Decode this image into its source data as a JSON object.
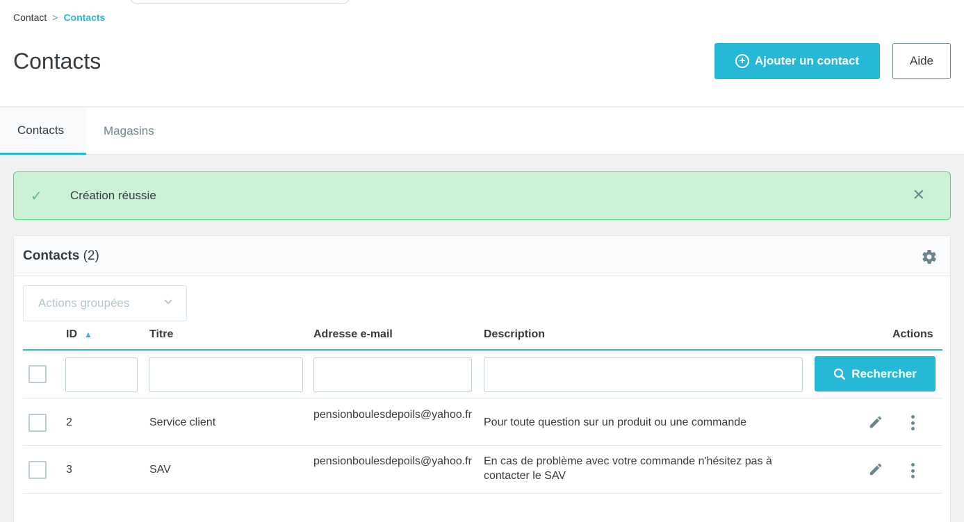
{
  "breadcrumb": {
    "parent": "Contact",
    "separator": ">",
    "current": "Contacts"
  },
  "page_title": "Contacts",
  "toolbar": {
    "add_label": "Ajouter un contact",
    "help_label": "Aide"
  },
  "tabs": [
    {
      "label": "Contacts",
      "active": true
    },
    {
      "label": "Magasins",
      "active": false
    }
  ],
  "alert": {
    "message": "Création réussie",
    "icon": "check-icon",
    "close_icon": "close-icon"
  },
  "panel": {
    "title": "Contacts",
    "count": "(2)",
    "settings_icon": "gear-icon"
  },
  "bulk_actions": {
    "label": "Actions groupées"
  },
  "columns": {
    "id": "ID",
    "title": "Titre",
    "email": "Adresse e-mail",
    "description": "Description",
    "actions": "Actions"
  },
  "search_button": "Rechercher",
  "rows": [
    {
      "id": "2",
      "title": "Service client",
      "email": "pensionboulesdepoils@yahoo.fr",
      "description": "Pour toute question sur un produit ou une commande"
    },
    {
      "id": "3",
      "title": "SAV",
      "email": "pensionboulesdepoils@yahoo.fr",
      "description": "En cas de problème avec votre commande n'hésitez pas à contacter le SAV"
    }
  ],
  "colors": {
    "accent": "#25b9d7",
    "success_bg": "#cbf2d4",
    "success_border": "#53d572",
    "text": "#363a41"
  }
}
